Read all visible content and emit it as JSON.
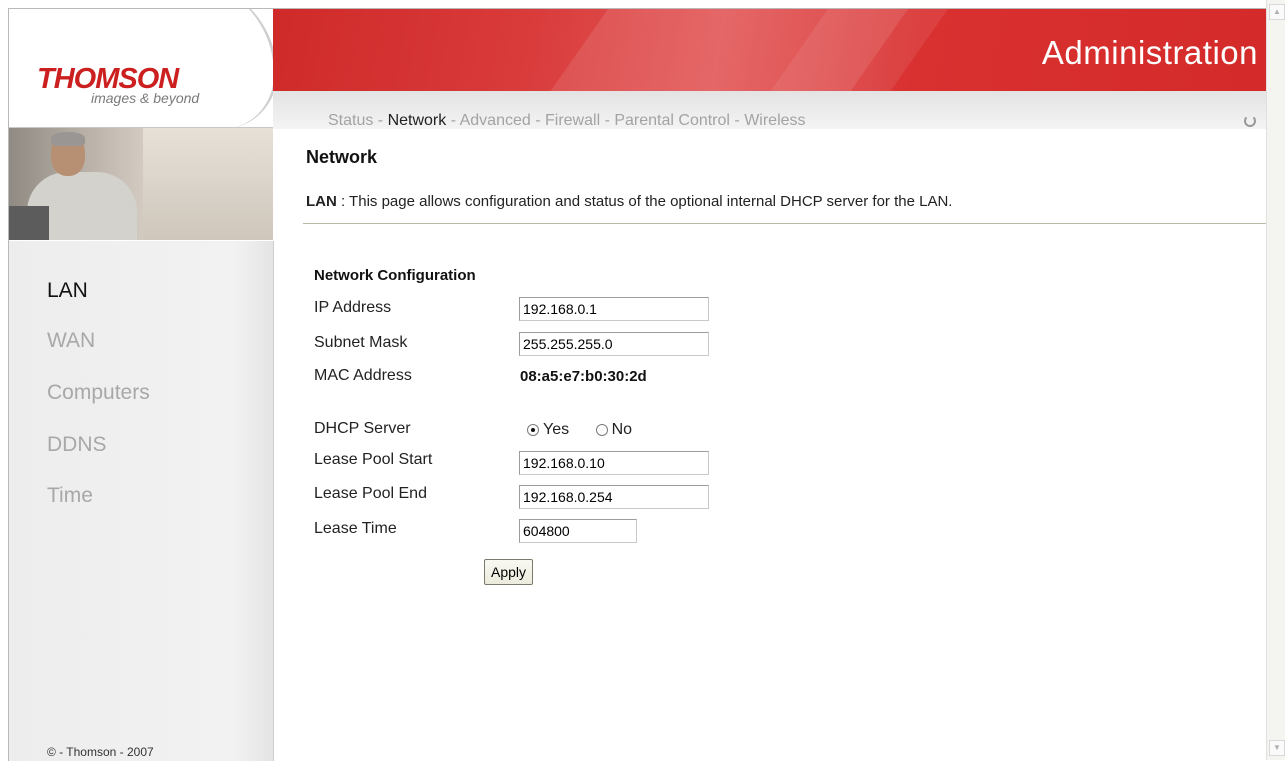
{
  "brand": {
    "logo": "THOMSON",
    "tagline": "images & beyond",
    "accent_color": "#d42a2a"
  },
  "header": {
    "title": "Administration",
    "menu": [
      {
        "label": "Status",
        "active": false
      },
      {
        "label": "Network",
        "active": true
      },
      {
        "label": "Advanced",
        "active": false
      },
      {
        "label": "Firewall",
        "active": false
      },
      {
        "label": "Parental Control",
        "active": false
      },
      {
        "label": "Wireless",
        "active": false
      }
    ],
    "separator": " - "
  },
  "sidebar": {
    "items": [
      {
        "label": "LAN",
        "active": true
      },
      {
        "label": "WAN",
        "active": false
      },
      {
        "label": "Computers",
        "active": false
      },
      {
        "label": "DDNS",
        "active": false
      },
      {
        "label": "Time",
        "active": false
      }
    ],
    "copyright": "© - Thomson - 2007"
  },
  "main": {
    "title": "Network",
    "desc_label": "LAN",
    "desc_text": " :  This page allows configuration and status of the optional internal DHCP server for the LAN.",
    "section_title": "Network Configuration",
    "ip_label": "IP Address",
    "ip_value": "192.168.0.1",
    "subnet_label": "Subnet Mask",
    "subnet_value": "255.255.255.0",
    "mac_label": "MAC Address",
    "mac_value": "08:a5:e7:b0:30:2d",
    "dhcp_label": "DHCP Server",
    "dhcp_yes": "Yes",
    "dhcp_no": "No",
    "dhcp_selected": "Yes",
    "pool_start_label": "Lease Pool Start",
    "pool_start_value": "192.168.0.10",
    "pool_end_label": "Lease Pool End",
    "pool_end_value": "192.168.0.254",
    "lease_time_label": "Lease Time",
    "lease_time_value": "604800",
    "apply_label": "Apply"
  }
}
